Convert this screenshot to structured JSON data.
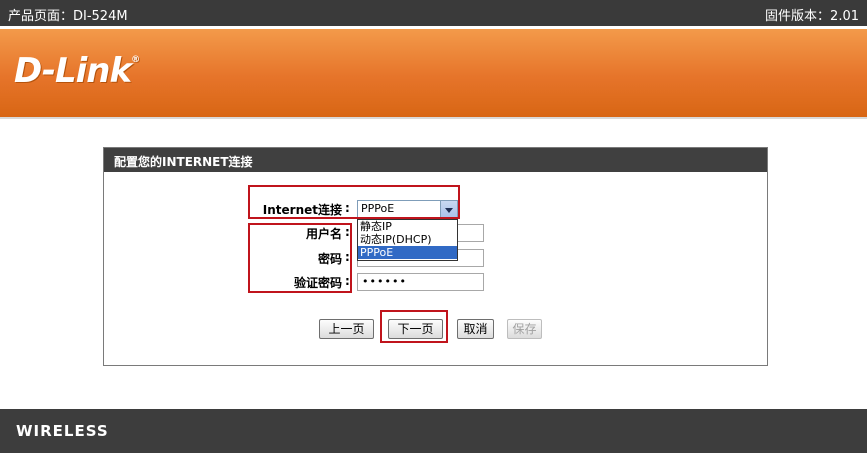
{
  "topbar": {
    "product": "产品页面：DI-524M",
    "firmware": "固件版本：2.01"
  },
  "logo": {
    "text": "D-Link",
    "mark": "®"
  },
  "panel": {
    "title": "配置您的INTERNET连接",
    "connection_label": "Internet连接",
    "colon": ":",
    "connection_value": "PPPoE",
    "options": [
      "静态IP",
      "动态IP(DHCP)",
      "PPPoE"
    ],
    "selected_option": "PPPoE",
    "username_label": "用户名",
    "username_value": "",
    "password_label": "密码",
    "password_value": "••••••",
    "verify_label": "验证密码",
    "verify_value": "••••••"
  },
  "buttons": {
    "prev": "上一页",
    "next": "下一页",
    "cancel": "取消",
    "save": "保存"
  },
  "footer": {
    "brand": "WIRELESS"
  },
  "colors": {
    "banner": "#e6742a",
    "bar": "#3a3a3a",
    "highlight": "#c0141c",
    "selected": "#316ac5"
  }
}
